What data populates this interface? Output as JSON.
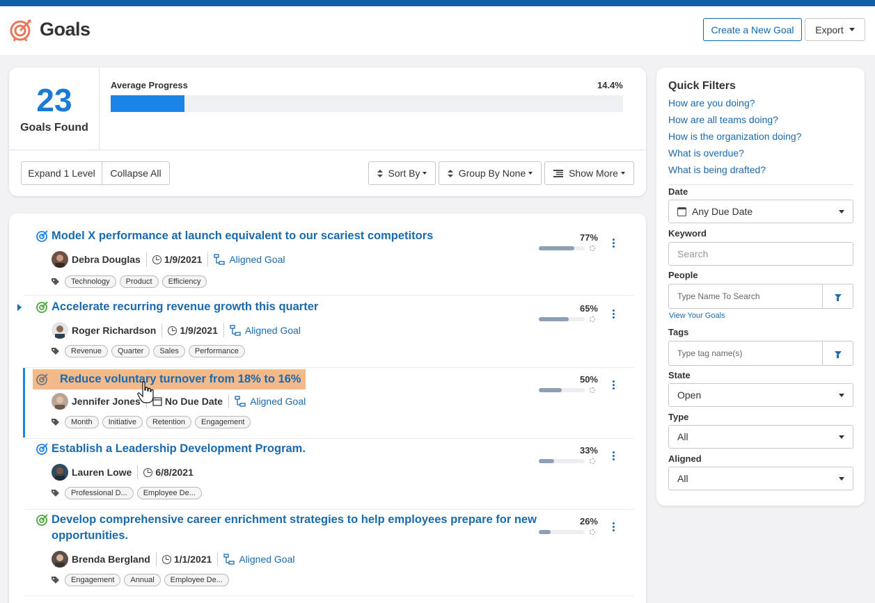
{
  "header": {
    "title": "Goals",
    "create_label": "Create a New Goal",
    "export_label": "Export"
  },
  "colors": {
    "accent": "#1a6aad",
    "brand_bar": "#1060a8",
    "progress": "#1a85e6",
    "highlight": "#f2b98a"
  },
  "summary": {
    "count": "23",
    "count_label": "Goals Found",
    "avg_label": "Average Progress",
    "avg_value": "14.4%",
    "avg_fraction": 0.144
  },
  "toolbar": {
    "expand_label": "Expand 1 Level",
    "collapse_label": "Collapse All",
    "sort_label": "Sort By",
    "group_label": "Group By None",
    "more_label": "Show More"
  },
  "goals": [
    {
      "title": "Model X performance at launch equivalent to our scariest competitors",
      "owner": "Debra Douglas",
      "date": "1/9/2021",
      "aligned": "Aligned Goal",
      "tags": [
        "Technology",
        "Product",
        "Efficiency"
      ],
      "progress": "77%",
      "progress_fraction": 0.77
    },
    {
      "title": "Accelerate recurring revenue growth this quarter",
      "owner": "Roger Richardson",
      "date": "1/9/2021",
      "aligned": "Aligned Goal",
      "tags": [
        "Revenue",
        "Quarter",
        "Sales",
        "Performance"
      ],
      "progress": "65%",
      "progress_fraction": 0.65
    },
    {
      "title": "Reduce voluntary turnover from 18% to 16%",
      "owner": "Jennifer Jones",
      "date": "No Due Date",
      "aligned": "Aligned Goal",
      "tags": [
        "Month",
        "Initiative",
        "Retention",
        "Engagement"
      ],
      "progress": "50%",
      "progress_fraction": 0.5
    },
    {
      "title": "Establish a Leadership Development Program.",
      "owner": "Lauren Lowe",
      "date": "6/8/2021",
      "aligned": "",
      "tags": [
        "Professional D...",
        "Employee De..."
      ],
      "progress": "33%",
      "progress_fraction": 0.33
    },
    {
      "title": "Develop comprehensive career enrichment strategies to help employees prepare for new opportunities.",
      "owner": "Brenda Bergland",
      "date": "1/1/2021",
      "aligned": "Aligned Goal",
      "tags": [
        "Engagement",
        "Annual",
        "Employee De..."
      ],
      "progress": "26%",
      "progress_fraction": 0.26
    }
  ],
  "filters": {
    "title": "Quick Filters",
    "links": [
      "How are you doing?",
      "How are all teams doing?",
      "How is the organization doing?",
      "What is overdue?",
      "What is being drafted?"
    ],
    "date_label": "Date",
    "date_value": "Any Due Date",
    "keyword_label": "Keyword",
    "keyword_placeholder": "Search",
    "people_label": "People",
    "people_placeholder": "Type Name To Search",
    "view_your_goals": "View Your Goals",
    "tags_label": "Tags",
    "tags_placeholder": "Type tag name(s)",
    "state_label": "State",
    "state_value": "Open",
    "type_label": "Type",
    "type_value": "All",
    "aligned_label": "Aligned",
    "aligned_value": "All"
  }
}
